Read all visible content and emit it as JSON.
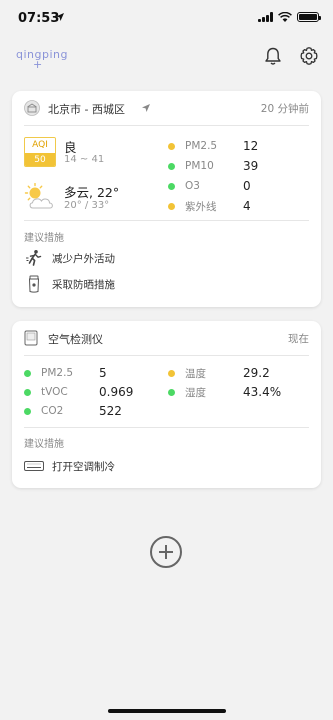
{
  "status_bar": {
    "time": "07:53"
  },
  "app": {
    "logo": "qingping",
    "logo_plus": "+"
  },
  "city_card": {
    "city": "北京市 - 西城区",
    "updated": "20 分钟前",
    "aqi_label": "AQI",
    "aqi_value": "50",
    "aqi_level": "良",
    "aqi_range": "14 ~ 41",
    "weather": "多云, 22°",
    "weather_range": "20° / 33°",
    "metrics": [
      {
        "label": "PM2.5",
        "value": "12",
        "color": "#f2c336"
      },
      {
        "label": "PM10",
        "value": "39",
        "color": "#4cd964"
      },
      {
        "label": "O3",
        "value": "0",
        "color": "#4cd964"
      },
      {
        "label": "紫外线",
        "value": "4",
        "color": "#f2c336"
      }
    ],
    "suggest_title": "建议措施",
    "suggestions": [
      {
        "text": "减少户外活动",
        "icon": "running-icon"
      },
      {
        "text": "采取防晒措施",
        "icon": "sunscreen-icon"
      }
    ]
  },
  "device_card": {
    "name": "空气检测仪",
    "updated": "现在",
    "metrics": [
      {
        "label": "PM2.5",
        "value": "5",
        "color": "#4cd964"
      },
      {
        "label": "温度",
        "value": "29.2",
        "color": "#f2c336"
      },
      {
        "label": "tVOC",
        "value": "0.969",
        "color": "#4cd964"
      },
      {
        "label": "湿度",
        "value": "43.4%",
        "color": "#4cd964"
      },
      {
        "label": "CO2",
        "value": "522",
        "color": "#4cd964"
      }
    ],
    "suggest_title": "建议措施",
    "suggestions": [
      {
        "text": "打开空调制冷",
        "icon": "air-conditioner-icon"
      }
    ]
  }
}
